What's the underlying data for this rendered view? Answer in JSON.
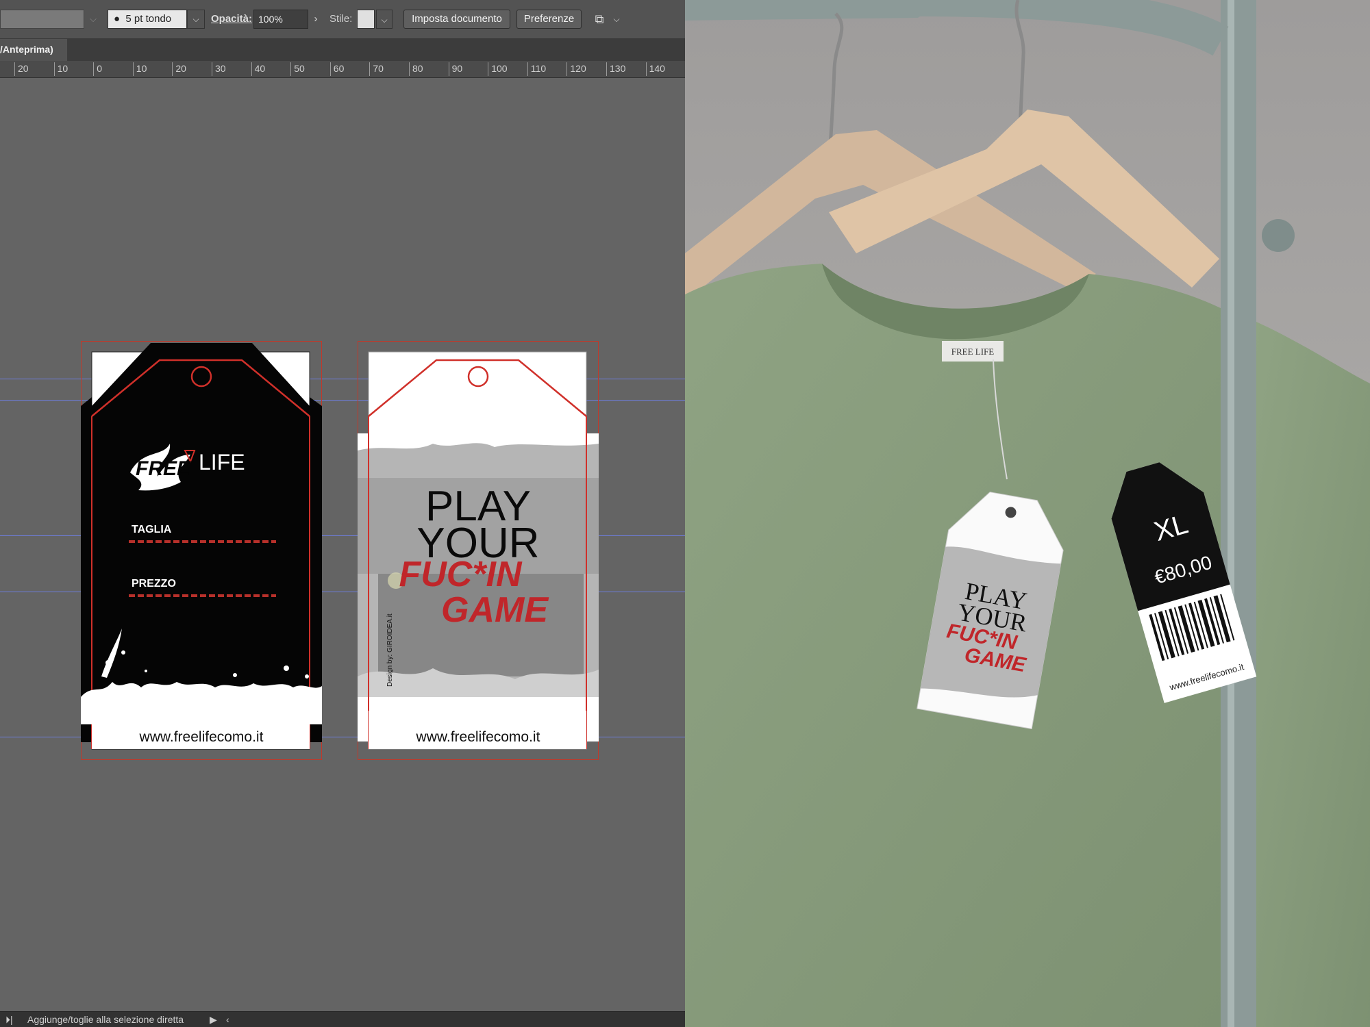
{
  "controlbar": {
    "brush_label": "5 pt tondo",
    "opacity_label": "Opacità:",
    "opacity_value": "100%",
    "style_label": "Stile:",
    "document_setup_button": "Imposta documento",
    "preferences_button": "Preferenze"
  },
  "tab": {
    "title": "/Anteprima)"
  },
  "ruler": {
    "ticks": [
      "20",
      "10",
      "0",
      "10",
      "20",
      "30",
      "40",
      "50",
      "60",
      "70",
      "80",
      "90",
      "100",
      "110",
      "120",
      "130",
      "140"
    ]
  },
  "front_tag": {
    "logo_left": "FREE",
    "logo_right": "LIFE",
    "size_label": "TAGLIA",
    "price_label": "PREZZO",
    "website": "www.freelifecomo.it"
  },
  "back_tag": {
    "headline_1": "PLAY",
    "headline_2": "YOUR",
    "tagline_1": "FUC*IN",
    "tagline_2": "GAME",
    "credit": "Design by: GIROIDEA.it",
    "website": "www.freelifecomo.it"
  },
  "mockup": {
    "collar_label": "FREE LIFE",
    "tag_headline_1": "PLAY",
    "tag_headline_2": "YOUR",
    "tag_tagline_1": "FUC*IN",
    "tag_tagline_2": "GAME",
    "back_tag_size": "XL",
    "back_tag_price": "€80,00",
    "back_tag_website": "www.freelifecomo.it"
  },
  "statusbar": {
    "text": "Aggiunge/toglie alla selezione diretta"
  },
  "colors": {
    "accent_red": "#c0392b",
    "guide_blue": "#6d7ee0",
    "shirt_green": "#8fa383"
  }
}
